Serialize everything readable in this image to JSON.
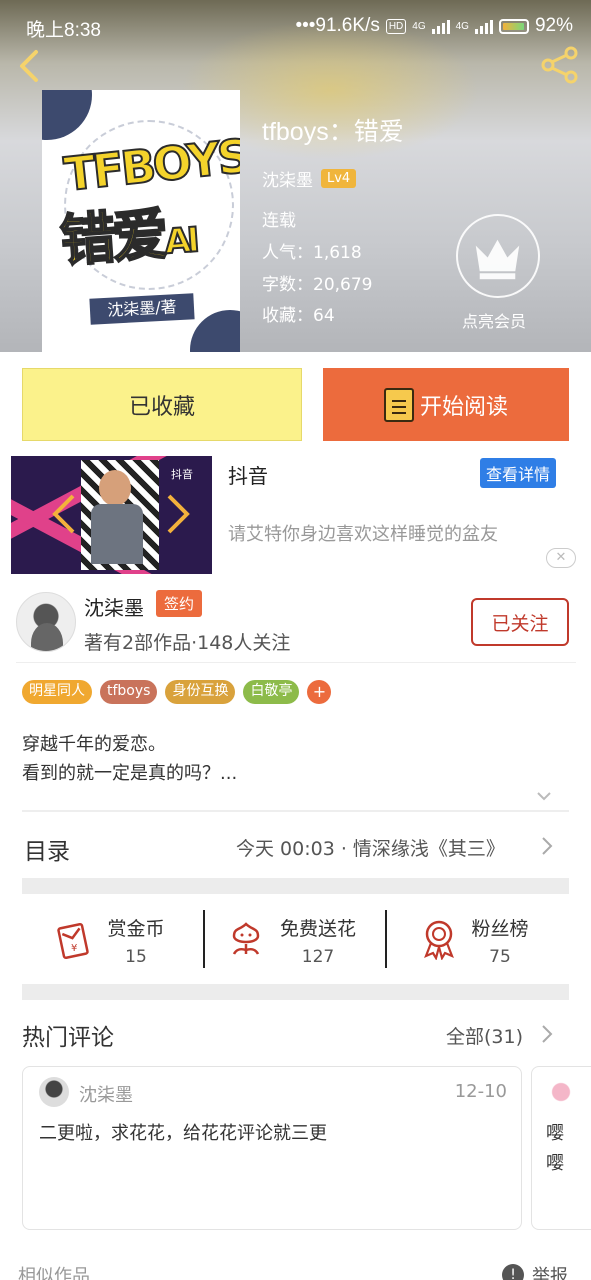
{
  "status_bar": {
    "time": "晚上8:38",
    "network_speed": "•••91.6K/s",
    "hd": "HD",
    "net1": "4G",
    "net2": "4G",
    "battery": "92%"
  },
  "book": {
    "title": "tfboys：错爱",
    "author": "沈柒墨",
    "level": "Lv4",
    "status": "连载",
    "popularity": "人气：1,618",
    "word_count": "字数：20,679",
    "favorites": "收藏：64",
    "cover": {
      "logo_top": "TFBOYS",
      "logo_main": "错爱",
      "logo_suffix": "AI",
      "author_tag": "沈柒墨/著"
    }
  },
  "vip": {
    "label": "点亮会员"
  },
  "actions": {
    "favorited_label": "已收藏",
    "read_label": "开始阅读"
  },
  "ad": {
    "title": "抖音",
    "detail_label": "查看详情",
    "description": "请艾特你身边喜欢这样睡觉的盆友",
    "close": "✕",
    "thumb_logo": "抖音"
  },
  "author": {
    "name": "沈柒墨",
    "badge": "签约",
    "stats": "著有2部作品·148人关注",
    "follow_label": "已关注"
  },
  "tags": [
    {
      "label": "明星同人",
      "color": "#f0a830"
    },
    {
      "label": "tfboys",
      "color": "#c9735b"
    },
    {
      "label": "身份互换",
      "color": "#d9a23c"
    },
    {
      "label": "白敬亭",
      "color": "#8dbb4a"
    }
  ],
  "tag_add": "+",
  "synopsis": {
    "line1": "穿越千年的爱恋。",
    "line2": "看到的就一定是真的吗？..."
  },
  "toc": {
    "label": "目录",
    "latest": "今天 00:03 · 情深缘浅《其三》"
  },
  "stats": [
    {
      "label": "赏金币",
      "value": "15",
      "icon": "red-envelope-icon"
    },
    {
      "label": "免费送花",
      "value": "127",
      "icon": "flower-icon"
    },
    {
      "label": "粉丝榜",
      "value": "75",
      "icon": "medal-icon"
    }
  ],
  "comments": {
    "label": "热门评论",
    "all_label": "全部(31)",
    "items": [
      {
        "user": "沈柒墨",
        "date": "12-10",
        "text": "二更啦，求花花，给花花评论就三更"
      },
      {
        "text_line1": "嘤",
        "text_line2": "嘤"
      }
    ]
  },
  "footer": {
    "similar": "相似作品",
    "report": "举报",
    "report_icon": "!"
  },
  "colors": {
    "accent": "#ec6b3d",
    "fav_button": "#fbf28b",
    "follow": "#c0392b",
    "link_blue": "#2f7ee6"
  }
}
